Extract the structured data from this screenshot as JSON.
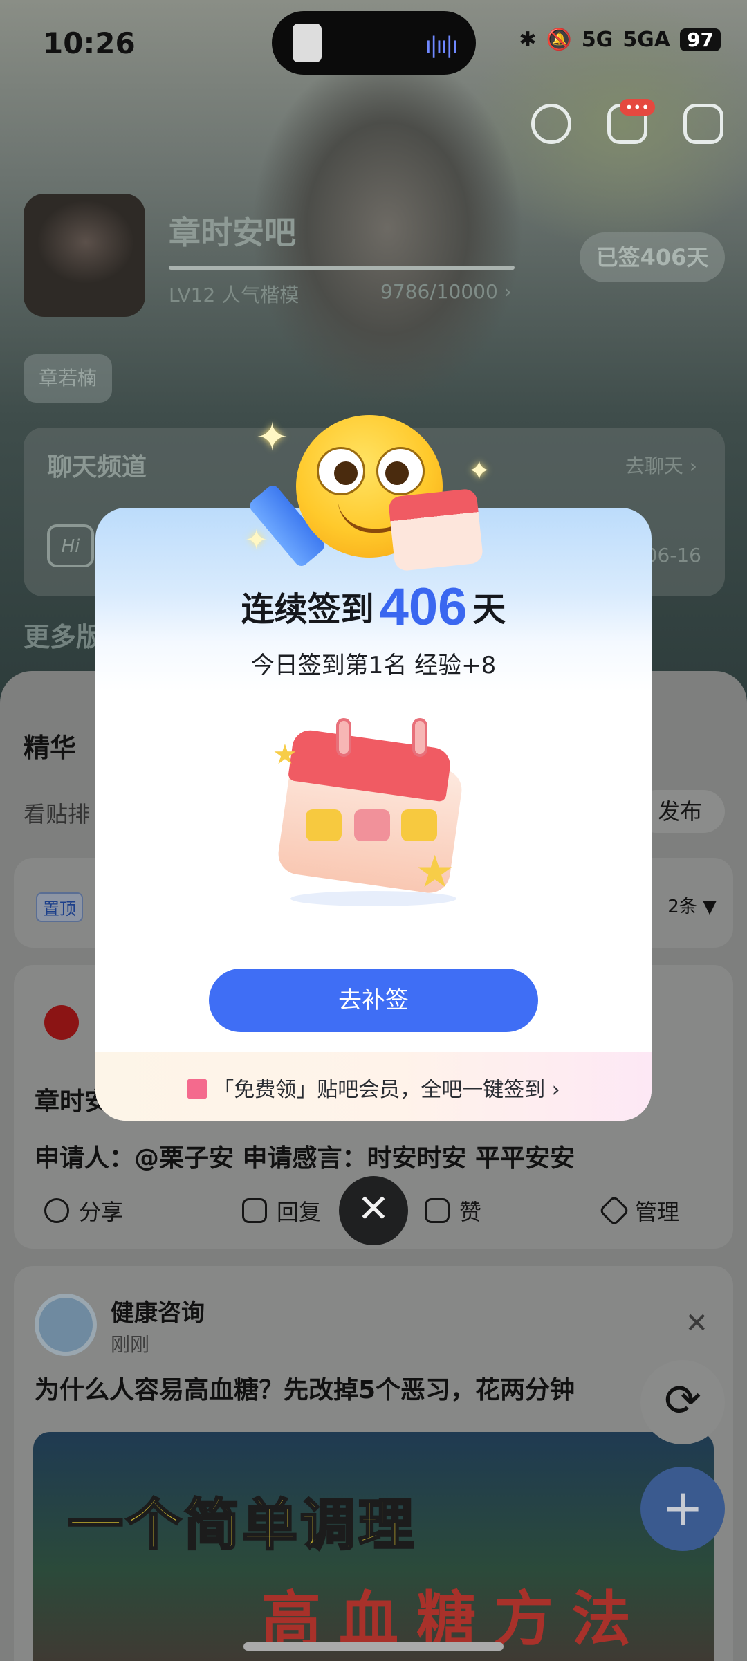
{
  "status_bar": {
    "time": "10:26",
    "network1": "5G",
    "network2": "5GA",
    "battery": "97"
  },
  "header": {
    "bar_name": "章时安吧",
    "level": "LV12 人气楷模",
    "exp": "9786/10000 ›",
    "signed": "已签406天",
    "tag": "章若楠",
    "chat_title": "聊天频道",
    "chat_go": "去聊天 ›",
    "chat_hi": "Hi",
    "chat_date": "06-16",
    "more_title": "更多版"
  },
  "feed": {
    "featured": "精华",
    "sort_label": "看贴排",
    "publish": "发布",
    "pin_tag": "置顶",
    "pin_count": "2条 ▼",
    "post": {
      "title": "章时安",
      "line": "申请人：@栗子安 申请感言：时安时安 平平安安",
      "actions": {
        "share": "分享",
        "reply": "回复",
        "like": "赞",
        "manage": "管理"
      }
    },
    "ad": {
      "name": "健康咨询",
      "time": "刚刚",
      "title": "为什么人容易高血糖？先改掉5个恶习，花两分钟",
      "image_text1": "一个简单调理",
      "image_text2": "高血糖方法"
    }
  },
  "modal": {
    "title_prefix": "连续签到",
    "days": "406",
    "title_suffix": "天",
    "subtitle": "今日签到第1名 经验+8",
    "cta": "去补签",
    "footer": "「免费领」贴吧会员，全吧一键签到 ›",
    "close": "✕"
  },
  "colors": {
    "accent": "#3f6ef5",
    "days_blue": "#3a67f0"
  }
}
